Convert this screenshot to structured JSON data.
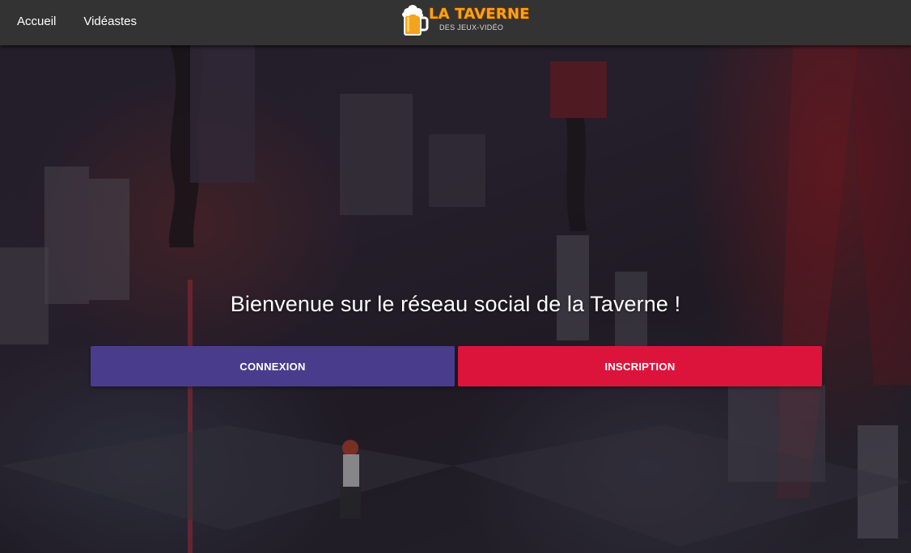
{
  "nav": {
    "links": [
      "Accueil",
      "Vidéastes"
    ]
  },
  "logo": {
    "title": "LA TAVERNE",
    "subtitle": "DES JEUX-VIDÉO",
    "mug_icon": "beer-mug-icon"
  },
  "hero": {
    "welcome": "Bienvenue sur le réseau social de la Taverne !",
    "login_label": "CONNEXION",
    "signup_label": "INSCRIPTION"
  },
  "colors": {
    "navbar": "#333333",
    "login_button": "#4a3c8c",
    "signup_button": "#dc143c",
    "logo_orange": "#f7a21c"
  }
}
